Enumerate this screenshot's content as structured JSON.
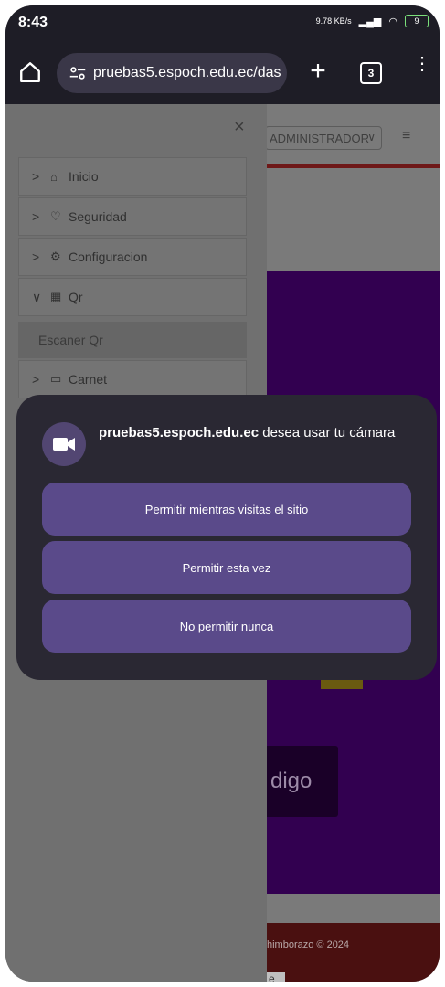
{
  "status_bar": {
    "time": "8:43",
    "net_speed": "9.78 KB/s",
    "battery": "9"
  },
  "browser": {
    "url": "pruebas5.espoch.edu.ec/das",
    "tab_count": "3",
    "new_tab_label": "+",
    "more_label": "⋮"
  },
  "page": {
    "role_select": "ADMINISTRADOR",
    "scanner_button_fragment": "digo",
    "footer_fragment": "himborazo © 2024",
    "footer_box": "e"
  },
  "sidebar": {
    "close": "×",
    "items": [
      {
        "label": "Inicio",
        "icon": "home-icon",
        "arrow": ">"
      },
      {
        "label": "Seguridad",
        "icon": "shield-icon",
        "arrow": ">"
      },
      {
        "label": "Configuracion",
        "icon": "gear-icon",
        "arrow": ">"
      },
      {
        "label": "Qr",
        "icon": "qr-icon",
        "arrow": "∨"
      },
      {
        "label": "Carnet",
        "icon": "card-icon",
        "arrow": ">"
      }
    ],
    "subitem": "Escaner Qr"
  },
  "permission_dialog": {
    "host": "pruebas5.espoch.edu.ec",
    "message": " desea usar tu cámara",
    "buttons": {
      "allow_while_visiting": "Permitir mientras visitas el sitio",
      "allow_once": "Permitir esta vez",
      "never_allow": "No permitir nunca"
    }
  },
  "colors": {
    "dialog_bg": "#2a2833",
    "button_bg": "#5a4a8a",
    "page_purple": "#320050"
  }
}
